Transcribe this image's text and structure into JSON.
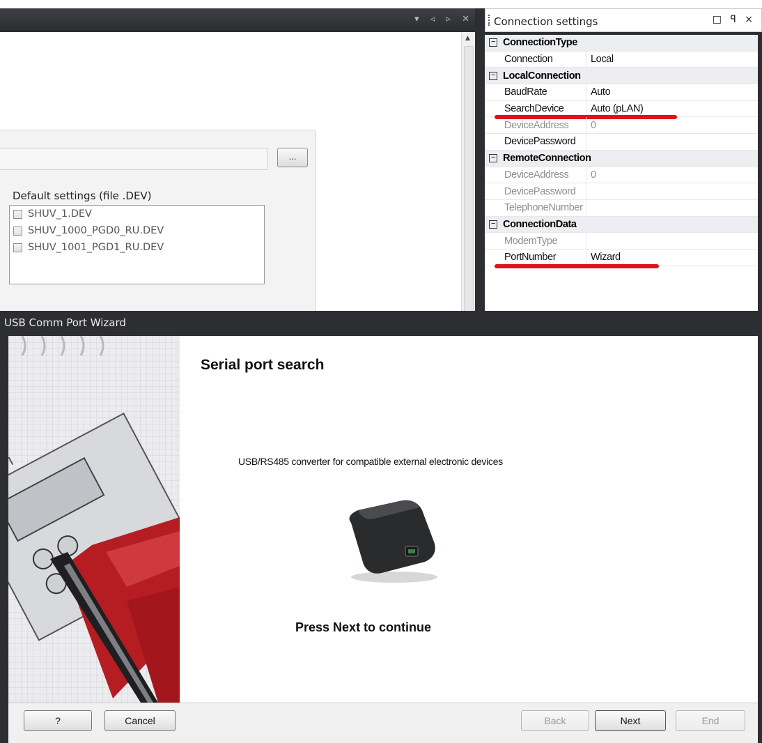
{
  "doc": {
    "path_value": "",
    "browse_label": "...",
    "default_settings_label": "Default settings (file .DEV)",
    "files": [
      "SHUV_1.DEV",
      "SHUV_1000_PGD0_RU.DEV",
      "SHUV_1001_PGD1_RU.DEV"
    ]
  },
  "connection_settings": {
    "title": "Connection settings",
    "controls": "□ ꟼ ×",
    "rows": [
      {
        "type": "category",
        "name": "ConnectionType"
      },
      {
        "type": "prop",
        "name": "Connection",
        "value": "Local",
        "disabled": false
      },
      {
        "type": "category",
        "name": "LocalConnection"
      },
      {
        "type": "prop",
        "name": "BaudRate",
        "value": "Auto",
        "disabled": false
      },
      {
        "type": "prop",
        "name": "SearchDevice",
        "value": "Auto (pLAN)",
        "disabled": false,
        "highlighted": true
      },
      {
        "type": "prop",
        "name": "DeviceAddress",
        "value": "0",
        "disabled": true
      },
      {
        "type": "prop",
        "name": "DevicePassword",
        "value": "",
        "disabled": false
      },
      {
        "type": "category",
        "name": "RemoteConnection"
      },
      {
        "type": "prop",
        "name": "DeviceAddress",
        "value": "0",
        "disabled": true
      },
      {
        "type": "prop",
        "name": "DevicePassword",
        "value": "",
        "disabled": true
      },
      {
        "type": "prop",
        "name": "TelephoneNumber",
        "value": "",
        "disabled": true
      },
      {
        "type": "category",
        "name": "ConnectionData"
      },
      {
        "type": "prop",
        "name": "ModemType",
        "value": "",
        "disabled": true
      },
      {
        "type": "prop",
        "name": "PortNumber",
        "value": "Wizard",
        "disabled": false,
        "highlighted": true
      }
    ],
    "highlight_color": "#e0121b"
  },
  "wizard": {
    "title": "USB Comm Port Wizard",
    "heading": "Serial port search",
    "description": "USB/RS485 converter for compatible external electronic devices",
    "prompt": "Press Next to continue",
    "buttons": {
      "help": "?",
      "cancel": "Cancel",
      "back": "Back",
      "next": "Next",
      "end": "End"
    }
  },
  "icons": {
    "expander": "minus-square-icon",
    "scroll_up": "scroll-up-arrow-icon",
    "checkbox": "checkbox-icon"
  }
}
